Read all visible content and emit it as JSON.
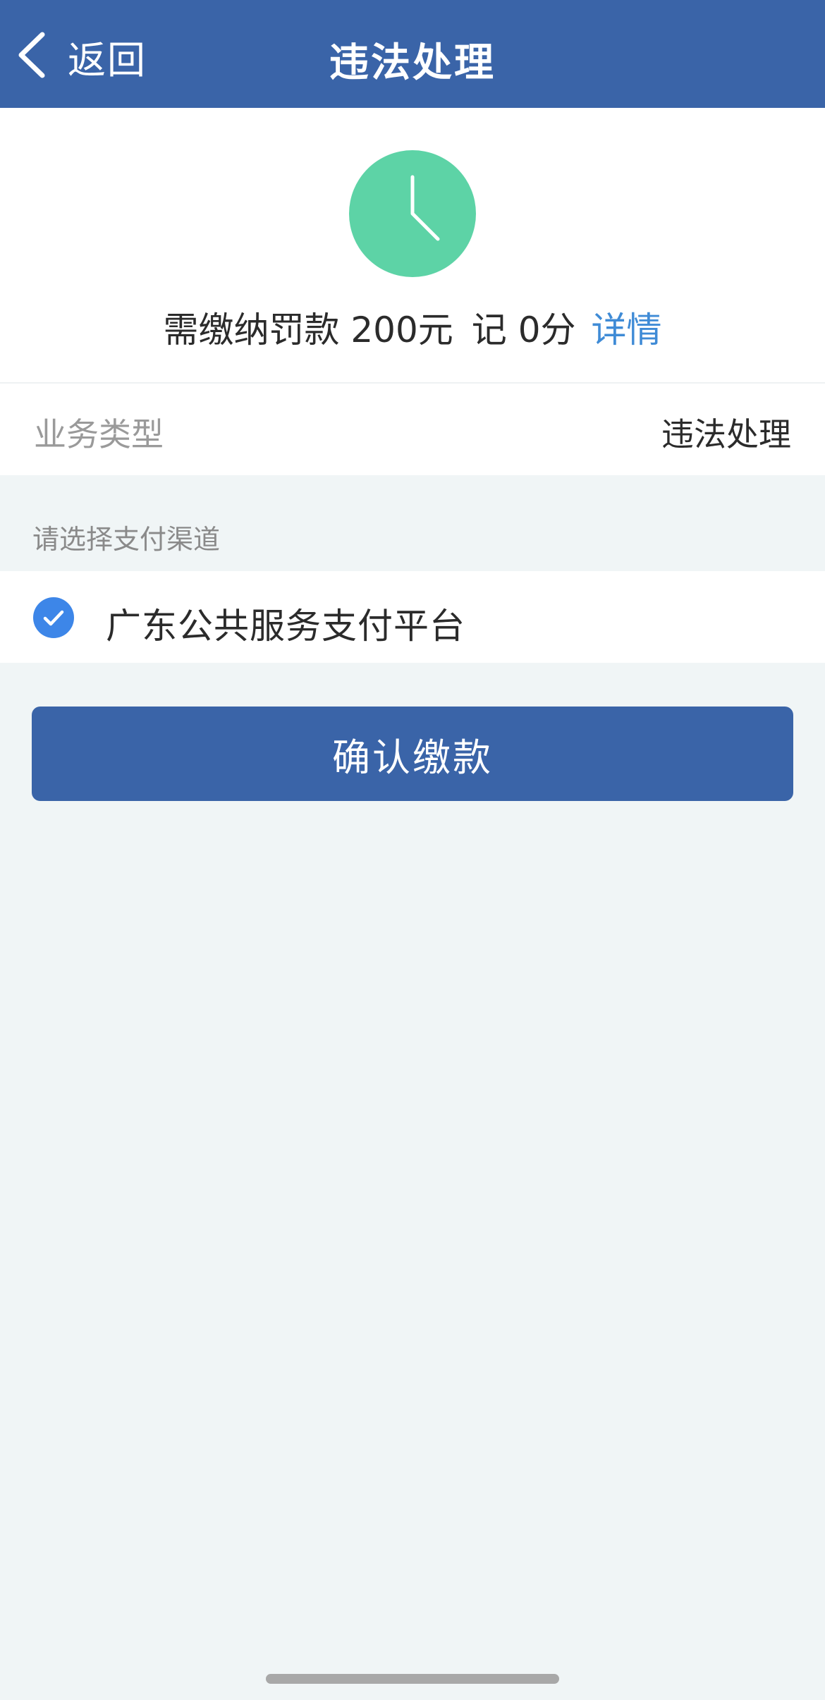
{
  "header": {
    "back_label": "返回",
    "title": "违法处理"
  },
  "summary": {
    "status_icon": "clock-icon",
    "fine_text": "需缴纳罚款 200元",
    "points_text": "记 0分",
    "details_link": "详情"
  },
  "business": {
    "label": "业务类型",
    "value": "违法处理"
  },
  "payment": {
    "section_title": "请选择支付渠道",
    "channels": [
      {
        "label": "广东公共服务支付平台",
        "selected": true
      }
    ]
  },
  "confirm_button": "确认缴款",
  "colors": {
    "header_bg": "#3a64a8",
    "clock_bg": "#5dd3a6",
    "link": "#3f8bd6",
    "check": "#3d86e8",
    "page_bg": "#f0f5f6"
  }
}
